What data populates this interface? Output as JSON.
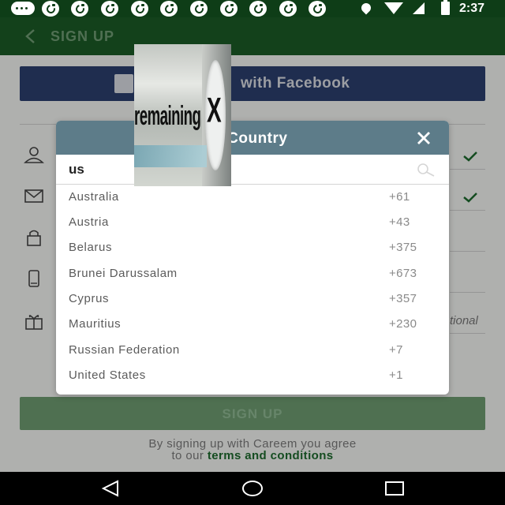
{
  "status_bar": {
    "time": "2:37",
    "notification_icons": [
      "more-notifications-icon",
      "music-icon",
      "music-icon",
      "music-icon",
      "music-icon",
      "music-icon",
      "music-icon",
      "music-icon",
      "music-icon",
      "music-icon",
      "music-icon"
    ],
    "system_icons": [
      "location-icon",
      "wifi-icon",
      "signal-icon",
      "battery-charging-icon"
    ]
  },
  "app_bar": {
    "title": "SIGN UP",
    "back_icon": "back-arrow-icon"
  },
  "form": {
    "facebook_button_label": "with Facebook",
    "fields": [
      {
        "icon": "person-icon",
        "validated": true
      },
      {
        "icon": "mail-icon",
        "validated": true
      },
      {
        "icon": "lock-icon",
        "validated": false
      },
      {
        "icon": "phone-icon",
        "validated": false
      },
      {
        "icon": "gift-icon",
        "validated": false
      }
    ],
    "optional_hint": "tional",
    "signup_button_label": "SIGN UP",
    "terms_text": "By signing up with Careem you agree",
    "terms_prefix": "to our",
    "terms_link": "terms and conditions"
  },
  "country_dialog": {
    "title": "t Country",
    "search_value": "us",
    "search_placeholder": "",
    "countries": [
      {
        "name": "Australia",
        "code": "+61"
      },
      {
        "name": "Austria",
        "code": "+43"
      },
      {
        "name": "Belarus",
        "code": "+375"
      },
      {
        "name": "Brunei Darussalam",
        "code": "+673"
      },
      {
        "name": "Cyprus",
        "code": "+357"
      },
      {
        "name": "Mauritius",
        "code": "+230"
      },
      {
        "name": "Russian Federation",
        "code": "+7"
      },
      {
        "name": "United States",
        "code": "+1"
      }
    ]
  },
  "ad_overlay": {
    "text": "remaining",
    "close_glyph": "X"
  },
  "nav_bar": {
    "buttons": [
      "back-icon",
      "home-icon",
      "recents-icon"
    ]
  },
  "colors": {
    "app_bar": "#1b5a26",
    "status_bar": "#0e3d17",
    "facebook": "#2c3f6e",
    "dialog_header": "#5d7c89",
    "signup_button": "#6e9c71",
    "terms_link": "#1d6a2d"
  }
}
